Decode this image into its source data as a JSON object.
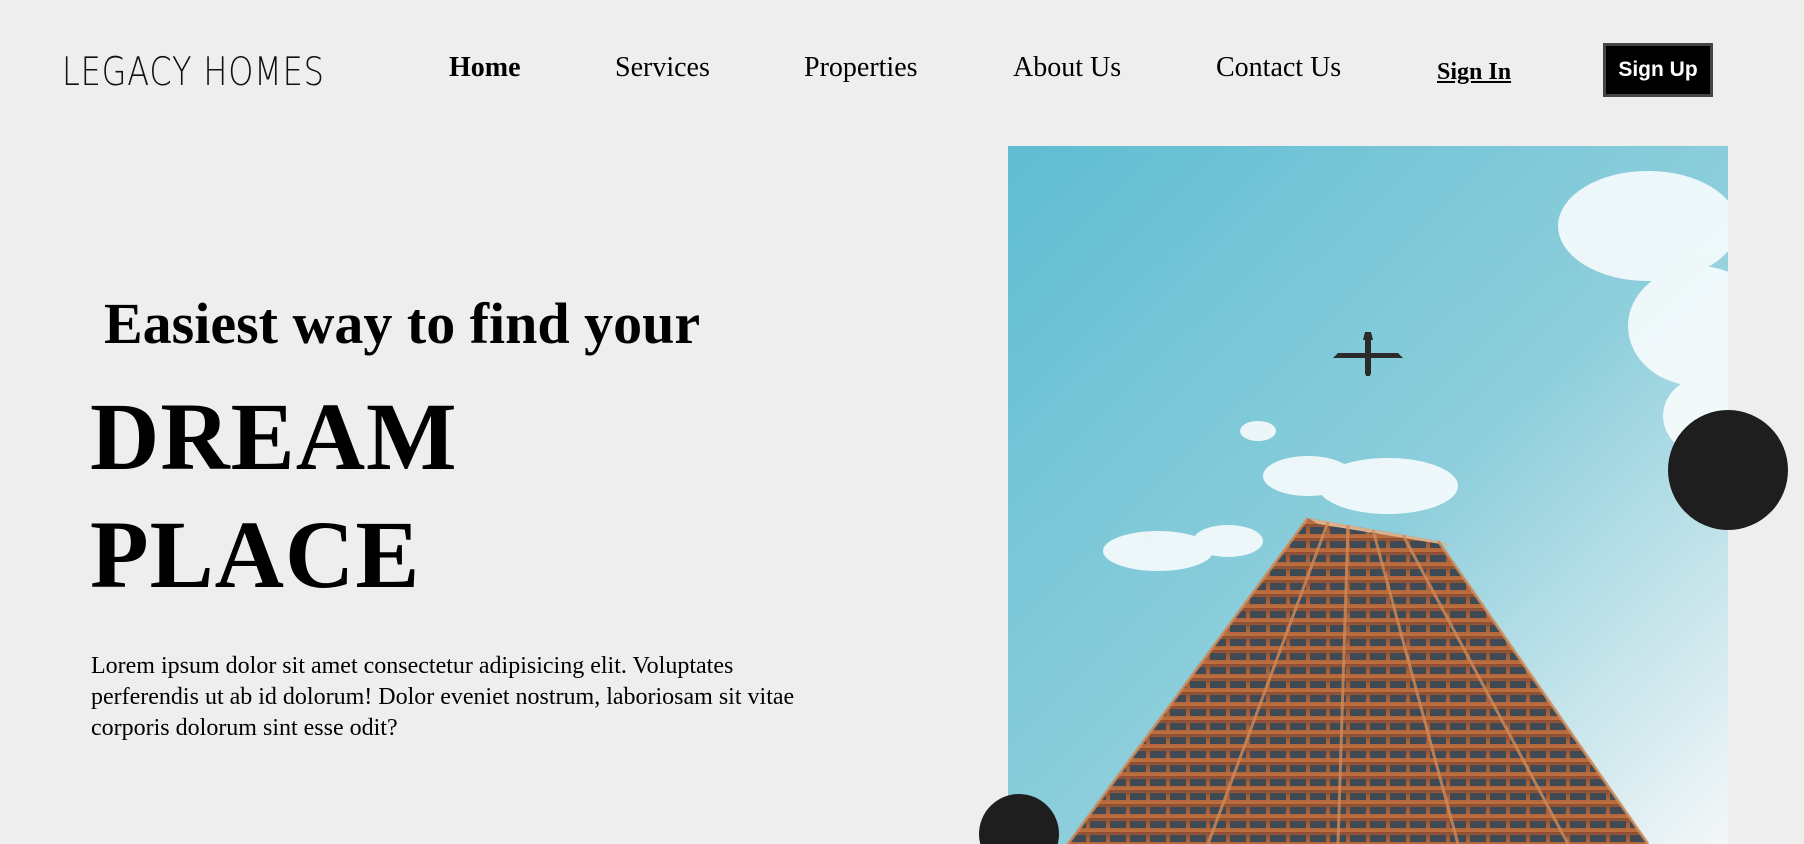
{
  "header": {
    "logo_text": "LEGACY HOMES",
    "nav": [
      {
        "label": "Home",
        "active": true
      },
      {
        "label": "Services",
        "active": false
      },
      {
        "label": "Properties",
        "active": false
      },
      {
        "label": "About Us",
        "active": false
      },
      {
        "label": "Contact Us",
        "active": false
      }
    ],
    "sign_in_label": "Sign In",
    "sign_up_label": "Sign Up"
  },
  "hero": {
    "tagline": "Easiest way to find your",
    "headline_line1": "DREAM",
    "headline_line2": "PLACE",
    "description": "Lorem ipsum dolor sit amet consectetur adipisicing elit. Voluptates perferendis ut ab id dolorum! Dolor eveniet nostrum, laboriosam sit vitae corporis dolorum sint esse odit?"
  },
  "colors": {
    "background": "#eeeeee",
    "accent": "#000000",
    "circle": "#1e1e1e",
    "sky": "#6cc3d5",
    "building": "#b8673a"
  }
}
